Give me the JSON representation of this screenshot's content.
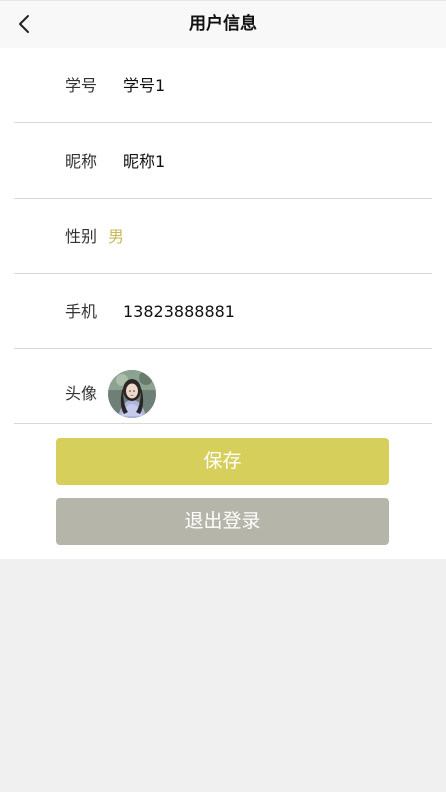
{
  "header": {
    "title": "用户信息"
  },
  "profile": {
    "student_id": {
      "label": "学号",
      "value": "学号1"
    },
    "nickname": {
      "label": "昵称",
      "value": "昵称1"
    },
    "gender": {
      "label": "性别",
      "value": "男"
    },
    "phone": {
      "label": "手机",
      "value": "13823888881"
    },
    "avatar": {
      "label": "头像"
    }
  },
  "actions": {
    "save_label": "保存",
    "logout_label": "退出登录"
  },
  "colors": {
    "save": "#d6cf5b",
    "logout": "#b5b5aa",
    "gender_value": "#c9b85a"
  },
  "icons": {
    "back": "chevron-left-icon"
  }
}
